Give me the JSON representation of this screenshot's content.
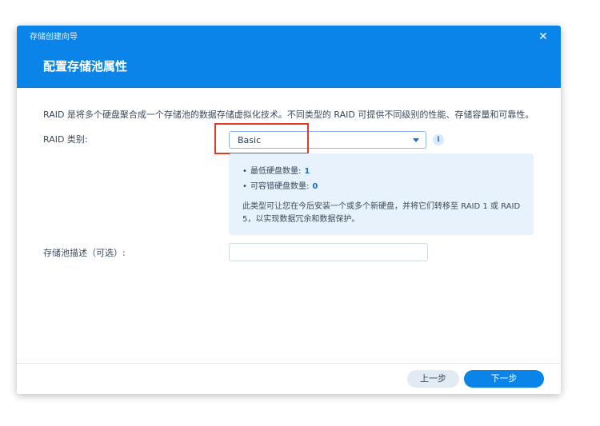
{
  "dialog": {
    "window_title": "存储创建向导",
    "close_glyph": "✕",
    "step_title": "配置存储池属性"
  },
  "intro": "RAID 是将多个硬盘聚合成一个存储池的数据存储虚拟化技术。不同类型的 RAID 可提供不同级别的性能、存储容量和可靠性。",
  "raid": {
    "label": "RAID 类别:",
    "selected": "Basic",
    "info_glyph": "i"
  },
  "info_panel": {
    "bullets": [
      {
        "label": "最低硬盘数量:",
        "value": "1"
      },
      {
        "label": "可容错硬盘数量:",
        "value": "0"
      }
    ],
    "description": "此类型可让您在今后安装一个或多个新硬盘，并将它们转移至 RAID 1 或 RAID 5，以实现数据冗余和数据保护。"
  },
  "pool_description": {
    "label": "存储池描述（可选）:",
    "value": ""
  },
  "footer": {
    "prev_label": "上一步",
    "next_label": "下一步"
  },
  "colors": {
    "header": "#0a84e8",
    "accent": "#1f6fd0",
    "info_panel_bg": "#e7f2fd",
    "highlight": "#e03a2a"
  },
  "icons": {
    "close": "close-icon",
    "info": "info-icon",
    "caret": "chevron-down-icon"
  }
}
